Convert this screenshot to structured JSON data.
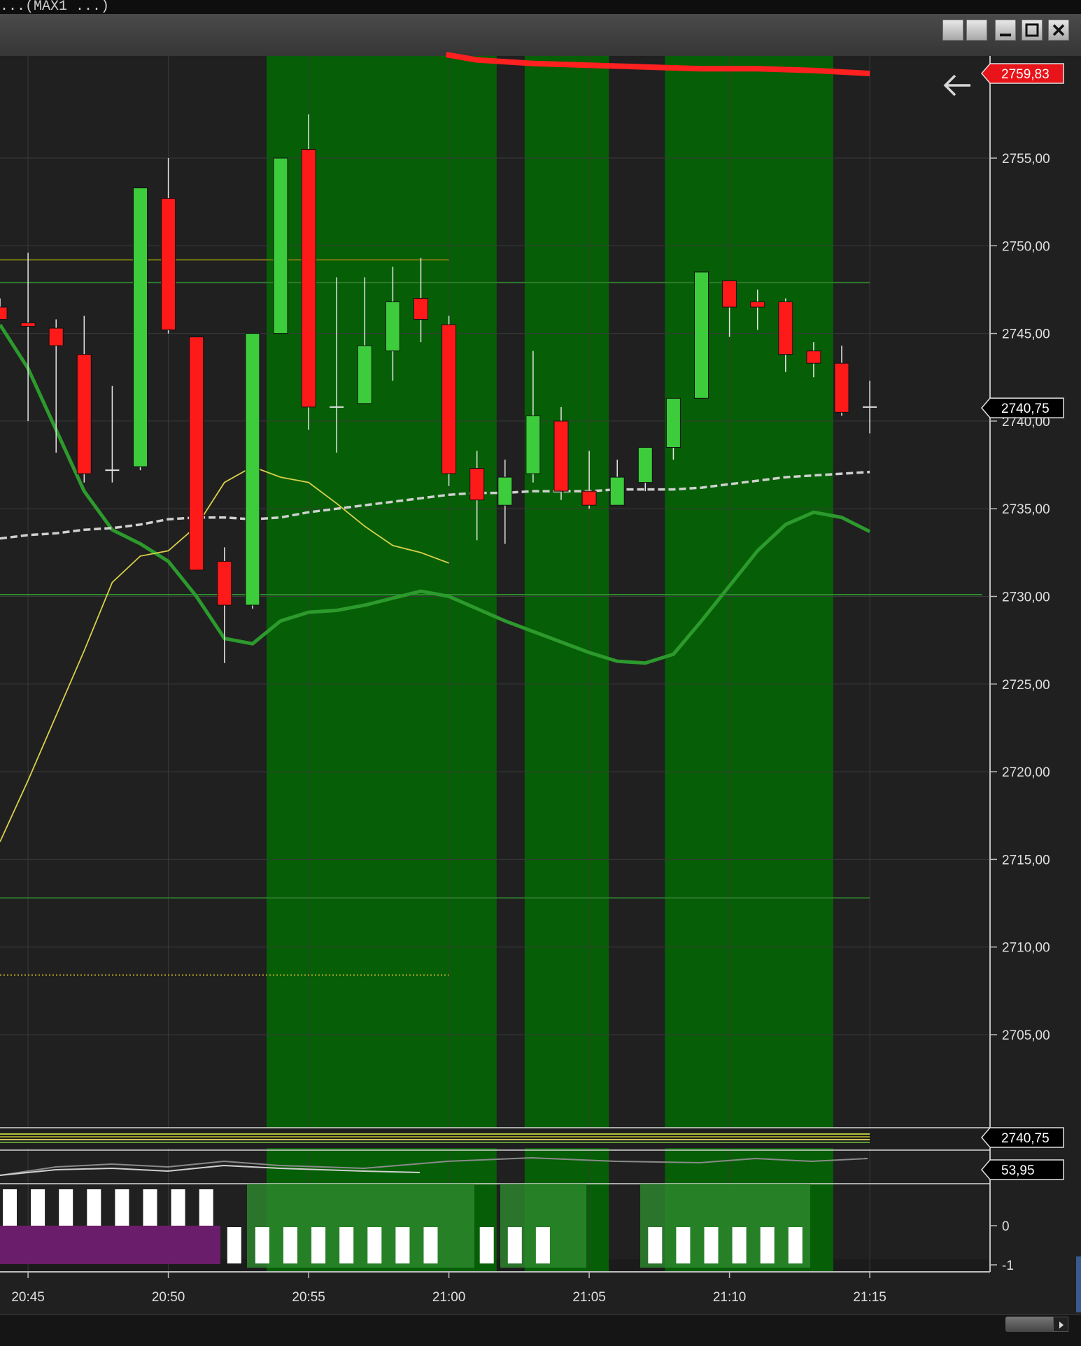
{
  "window": {
    "title": "...(MAX1 ...)",
    "buttons": [
      "restore-left",
      "restore-right",
      "minimize",
      "maximize",
      "close"
    ]
  },
  "icons": [
    "back-arrow-icon"
  ],
  "colors": {
    "background": "#202020",
    "bull": "#3ccc3c",
    "bear": "#ff1a1a",
    "highlight_band": "#065f06",
    "ma_thick": "#2c9a2c",
    "ma_thin": "#d8d048",
    "ma_dashed": "#d0d0d0",
    "resistance": "#ff2020",
    "oscillator_purple": "#6a1d6a"
  },
  "chart_data": {
    "type": "candlestick",
    "x_axis_labels": [
      "20:45",
      "20:50",
      "20:55",
      "21:00",
      "21:05",
      "21:10",
      "21:15"
    ],
    "y_tick_labels": [
      "2755,00",
      "2750,00",
      "2745,00",
      "2740,00",
      "2735,00",
      "2730,00",
      "2725,00",
      "2720,00",
      "2715,00",
      "2710,00",
      "2705,00"
    ],
    "ylim": [
      2699.8,
      2761.0
    ],
    "current_price_label": "2740,75",
    "resistance_label": "2759,83",
    "candles": [
      {
        "t": "20:44",
        "o": 2746.5,
        "h": 2747.0,
        "l": 2746.0,
        "c": 2745.8
      },
      {
        "t": "20:45",
        "o": 2745.6,
        "h": 2749.6,
        "l": 2740.0,
        "c": 2745.4
      },
      {
        "t": "20:46",
        "o": 2745.3,
        "h": 2745.8,
        "l": 2738.2,
        "c": 2744.3
      },
      {
        "t": "20:47",
        "o": 2743.8,
        "h": 2746.0,
        "l": 2736.5,
        "c": 2737.0
      },
      {
        "t": "20:48",
        "o": 2737.2,
        "h": 2742.0,
        "l": 2736.5,
        "c": 2737.2
      },
      {
        "t": "20:49",
        "o": 2737.4,
        "h": 2753.3,
        "l": 2737.2,
        "c": 2753.3
      },
      {
        "t": "20:50",
        "o": 2752.7,
        "h": 2755.0,
        "l": 2745.0,
        "c": 2745.2
      },
      {
        "t": "20:51",
        "o": 2744.8,
        "h": 2744.8,
        "l": 2731.5,
        "c": 2731.5
      },
      {
        "t": "20:52",
        "o": 2732.0,
        "h": 2732.8,
        "l": 2726.2,
        "c": 2729.5
      },
      {
        "t": "20:53",
        "o": 2729.5,
        "h": 2745.0,
        "l": 2729.3,
        "c": 2745.0
      },
      {
        "t": "20:54",
        "o": 2745.0,
        "h": 2755.0,
        "l": 2745.0,
        "c": 2755.0
      },
      {
        "t": "20:55",
        "o": 2755.5,
        "h": 2757.5,
        "l": 2739.5,
        "c": 2740.8
      },
      {
        "t": "20:56",
        "o": 2740.8,
        "h": 2748.2,
        "l": 2738.2,
        "c": 2740.8
      },
      {
        "t": "20:57",
        "o": 2741.0,
        "h": 2748.2,
        "l": 2741.0,
        "c": 2744.3
      },
      {
        "t": "20:58",
        "o": 2744.0,
        "h": 2748.8,
        "l": 2742.3,
        "c": 2746.8
      },
      {
        "t": "20:59",
        "o": 2747.0,
        "h": 2749.3,
        "l": 2744.5,
        "c": 2745.8
      },
      {
        "t": "21:00",
        "o": 2745.5,
        "h": 2746.0,
        "l": 2736.3,
        "c": 2737.0
      },
      {
        "t": "21:01",
        "o": 2737.3,
        "h": 2738.3,
        "l": 2733.2,
        "c": 2735.5
      },
      {
        "t": "21:02",
        "o": 2735.2,
        "h": 2737.8,
        "l": 2733.0,
        "c": 2736.8
      },
      {
        "t": "21:03",
        "o": 2737.0,
        "h": 2744.0,
        "l": 2736.5,
        "c": 2740.3
      },
      {
        "t": "21:04",
        "o": 2740.0,
        "h": 2740.8,
        "l": 2735.5,
        "c": 2736.0
      },
      {
        "t": "21:05",
        "o": 2736.0,
        "h": 2738.3,
        "l": 2735.0,
        "c": 2735.2
      },
      {
        "t": "21:06",
        "o": 2735.2,
        "h": 2737.8,
        "l": 2735.2,
        "c": 2736.8
      },
      {
        "t": "21:07",
        "o": 2736.5,
        "h": 2738.5,
        "l": 2736.0,
        "c": 2738.5
      },
      {
        "t": "21:08",
        "o": 2738.5,
        "h": 2741.3,
        "l": 2737.8,
        "c": 2741.3
      },
      {
        "t": "21:09",
        "o": 2741.3,
        "h": 2748.5,
        "l": 2741.3,
        "c": 2748.5
      },
      {
        "t": "21:10",
        "o": 2748.0,
        "h": 2748.0,
        "l": 2744.8,
        "c": 2746.5
      },
      {
        "t": "21:11",
        "o": 2746.8,
        "h": 2747.5,
        "l": 2745.2,
        "c": 2746.5
      },
      {
        "t": "21:12",
        "o": 2746.8,
        "h": 2747.0,
        "l": 2742.8,
        "c": 2743.8
      },
      {
        "t": "21:13",
        "o": 2744.0,
        "h": 2744.5,
        "l": 2742.5,
        "c": 2743.3
      },
      {
        "t": "21:14",
        "o": 2743.3,
        "h": 2744.3,
        "l": 2740.3,
        "c": 2740.5
      },
      {
        "t": "21:15",
        "o": 2740.8,
        "h": 2742.3,
        "l": 2739.3,
        "c": 2740.8
      }
    ],
    "highlight_bands": [
      {
        "from": "20:53.5",
        "to": "21:01.7"
      },
      {
        "from": "21:02.7",
        "to": "21:05.7"
      },
      {
        "from": "21:07.7",
        "to": "21:13.7"
      }
    ],
    "series": [
      {
        "style": "ma_thick",
        "t": [
          "20:44",
          "20:45",
          "20:46",
          "20:47",
          "20:48",
          "20:49",
          "20:50",
          "20:51",
          "20:52",
          "20:53",
          "20:54",
          "20:55",
          "20:56",
          "20:57",
          "20:58",
          "20:59",
          "21:00",
          "21:01",
          "21:02",
          "21:03",
          "21:04",
          "21:05",
          "21:06",
          "21:07",
          "21:08",
          "21:09",
          "21:10",
          "21:11",
          "21:12",
          "21:13",
          "21:14",
          "21:15"
        ],
        "values": [
          2745.5,
          2743.0,
          2739.5,
          2736.0,
          2733.8,
          2733.0,
          2732.0,
          2730.0,
          2727.6,
          2727.3,
          2728.6,
          2729.1,
          2729.2,
          2729.5,
          2729.9,
          2730.3,
          2730.0,
          2729.3,
          2728.6,
          2728.0,
          2727.4,
          2726.8,
          2726.3,
          2726.2,
          2726.7,
          2728.6,
          2730.6,
          2732.6,
          2734.1,
          2734.8,
          2734.5,
          2733.7
        ]
      },
      {
        "style": "ma_dashed",
        "t": [
          "20:44",
          "20:45",
          "20:46",
          "20:47",
          "20:48",
          "20:49",
          "20:50",
          "20:51",
          "20:52",
          "20:53",
          "20:54",
          "20:55",
          "20:56",
          "20:57",
          "20:58",
          "20:59",
          "21:00",
          "21:01",
          "21:02",
          "21:03",
          "21:04",
          "21:05",
          "21:06",
          "21:07",
          "21:08",
          "21:09",
          "21:10",
          "21:11",
          "21:12",
          "21:13",
          "21:14",
          "21:15"
        ],
        "values": [
          2733.3,
          2733.5,
          2733.6,
          2733.8,
          2733.9,
          2734.1,
          2734.4,
          2734.5,
          2734.5,
          2734.4,
          2734.5,
          2734.8,
          2735.0,
          2735.2,
          2735.4,
          2735.6,
          2735.8,
          2735.9,
          2735.9,
          2736.0,
          2736.0,
          2736.0,
          2736.1,
          2736.1,
          2736.1,
          2736.2,
          2736.4,
          2736.6,
          2736.8,
          2736.9,
          2737.0,
          2737.1
        ]
      },
      {
        "style": "ma_thin",
        "t": [
          "20:44",
          "20:45",
          "20:46",
          "20:47",
          "20:48",
          "20:49",
          "20:50",
          "20:51",
          "20:52",
          "20:53",
          "20:54",
          "20:55",
          "20:56",
          "20:57",
          "20:58",
          "20:59",
          "21:00"
        ],
        "values": [
          2716.0,
          2719.5,
          2723.2,
          2726.9,
          2730.8,
          2732.3,
          2732.6,
          2734.0,
          2736.5,
          2737.4,
          2736.8,
          2736.5,
          2735.3,
          2734.0,
          2732.9,
          2732.5,
          2731.9
        ]
      },
      {
        "style": "resistance",
        "t": [
          "20:59.9",
          "21:01",
          "21:03",
          "21:05",
          "21:07",
          "21:09",
          "21:11",
          "21:13",
          "21:15"
        ],
        "values": [
          2760.9,
          2760.6,
          2760.4,
          2760.3,
          2760.2,
          2760.1,
          2760.1,
          2760.0,
          2759.83
        ]
      }
    ],
    "horizontal_levels": [
      {
        "value": 2749.2,
        "to": "21:00",
        "color": "#7a7a10"
      },
      {
        "value": 2747.9,
        "to": "21:15",
        "color": "#2e7a2e"
      },
      {
        "value": 2730.1,
        "to": "21:19",
        "color": "#2e8a2e"
      },
      {
        "value": 2712.8,
        "to": "21:15",
        "color": "#2e7a2e"
      },
      {
        "value": 2708.4,
        "to": "21:00",
        "color": "#b0a020",
        "dotted": true
      }
    ],
    "subpanels": [
      {
        "label": "2740,75"
      },
      {
        "label": "53,95"
      },
      {
        "y_tick_labels": [
          "0",
          "-1"
        ],
        "bars": [
          1,
          1,
          1,
          1,
          1,
          1,
          1,
          1,
          -1,
          -1,
          -1,
          -1,
          -1,
          -1,
          -1,
          -1,
          0,
          -1,
          -1,
          -1,
          0,
          0,
          0,
          -1,
          -1,
          -1,
          -1,
          -1,
          -1
        ]
      }
    ]
  }
}
